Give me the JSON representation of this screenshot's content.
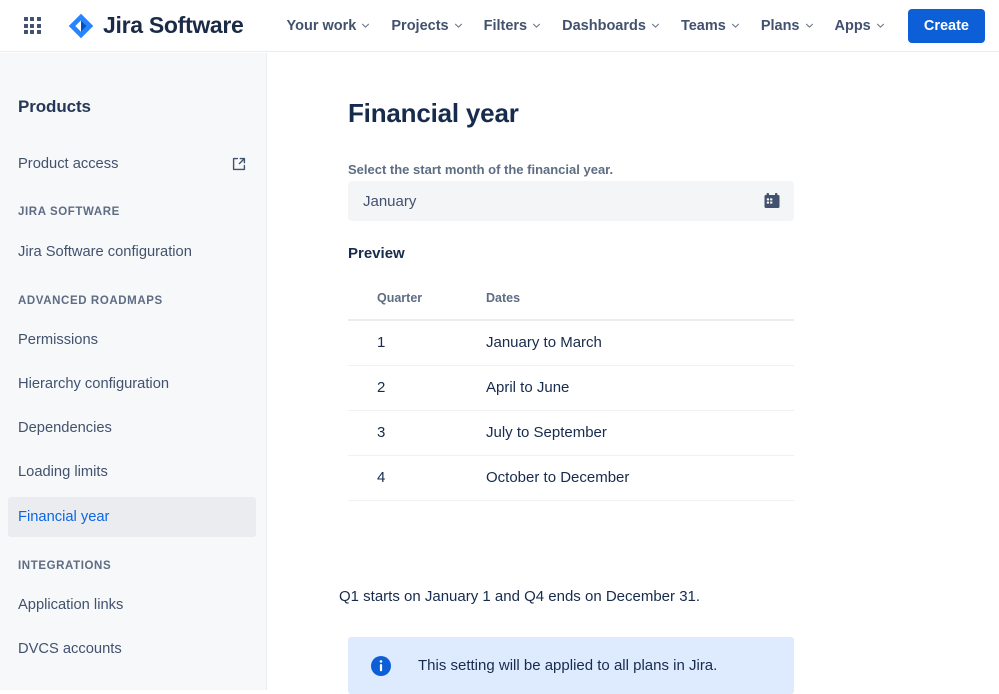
{
  "topnav": {
    "app_switcher_icon": "grid-apps-icon",
    "brand": {
      "logo_icon": "jira-diamond-logo",
      "name": "Jira Software"
    },
    "items": [
      {
        "label": "Your work",
        "has_chevron": true
      },
      {
        "label": "Projects",
        "has_chevron": true
      },
      {
        "label": "Filters",
        "has_chevron": true
      },
      {
        "label": "Dashboards",
        "has_chevron": true
      },
      {
        "label": "Teams",
        "has_chevron": true
      },
      {
        "label": "Plans",
        "has_chevron": true
      },
      {
        "label": "Apps",
        "has_chevron": true
      }
    ],
    "create_label": "Create",
    "create_color": "#0C5FD6"
  },
  "sidebar": {
    "title": "Products",
    "groups": [
      {
        "heading": null,
        "items": [
          {
            "label": "Product access",
            "external": true,
            "selected": false,
            "external_icon": "external-link-icon"
          }
        ]
      },
      {
        "heading": "JIRA SOFTWARE",
        "items": [
          {
            "label": "Jira Software configuration",
            "external": false,
            "selected": false
          }
        ]
      },
      {
        "heading": "ADVANCED ROADMAPS",
        "items": [
          {
            "label": "Permissions",
            "external": false,
            "selected": false
          },
          {
            "label": "Hierarchy configuration",
            "external": false,
            "selected": false
          },
          {
            "label": "Dependencies",
            "external": false,
            "selected": false
          },
          {
            "label": "Loading limits",
            "external": false,
            "selected": false
          },
          {
            "label": "Financial year",
            "external": false,
            "selected": true
          }
        ]
      },
      {
        "heading": "INTEGRATIONS",
        "items": [
          {
            "label": "Application links",
            "external": false,
            "selected": false
          },
          {
            "label": "DVCS accounts",
            "external": false,
            "selected": false
          }
        ]
      }
    ],
    "selected_text_color": "#0C66E4",
    "selected_bg_color": "#EBECF0"
  },
  "main": {
    "page_title": "Financial year",
    "field_label": "Select the start month of the financial year.",
    "start_month_value": "January",
    "start_month_icon": "calendar-icon",
    "preview_title": "Preview",
    "table": {
      "columns": [
        "Quarter",
        "Dates"
      ],
      "rows": [
        [
          "1",
          "January to March"
        ],
        [
          "2",
          "April to June"
        ],
        [
          "3",
          "July to September"
        ],
        [
          "4",
          "October to December"
        ]
      ]
    },
    "note": "Q1 starts on January 1 and Q4 ends on December 31.",
    "info_banner": {
      "icon": "info-circle-icon",
      "text": "This setting will be applied to all plans in Jira.",
      "bg_color": "#DEEBFF",
      "icon_color": "#0C5FD6"
    }
  }
}
